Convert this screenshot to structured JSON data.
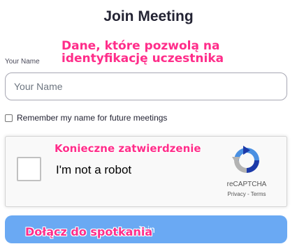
{
  "page": {
    "title": "Join Meeting"
  },
  "name_field": {
    "label": "Your Name",
    "placeholder": "Your Name",
    "value": ""
  },
  "remember": {
    "label": "Remember my name for future meetings",
    "checked": false
  },
  "recaptcha": {
    "checkbox_text": "I'm not a robot",
    "brand": "reCAPTCHA",
    "links": "Privacy - Terms",
    "logo_icon": "recaptcha-logo-icon"
  },
  "join_button": {
    "label": "Join"
  },
  "annotations": {
    "name_note": "Dane, które pozwolą na identyfikację uczestnika",
    "captcha_note": "Konieczne zatwierdzenie",
    "join_note": "Dołącz do spotkania"
  },
  "colors": {
    "accent": "#6aa9f3",
    "annotation": "#ff2d8a"
  }
}
